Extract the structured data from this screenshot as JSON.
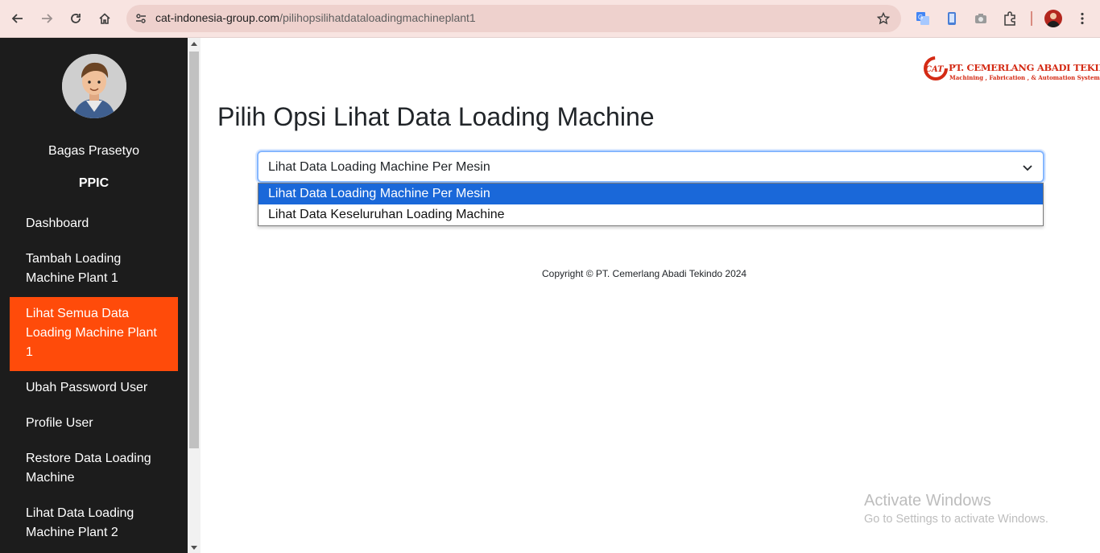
{
  "browser": {
    "url_domain": "cat-indonesia-group.com",
    "url_path": "/pilihopsilihatdataloadingmachineplant1"
  },
  "sidebar": {
    "user_name": "Bagas Prasetyo",
    "user_role": "PPIC",
    "items": [
      {
        "label": "Dashboard"
      },
      {
        "label": "Tambah Loading Machine Plant 1"
      },
      {
        "label": "Lihat Semua Data Loading Machine Plant 1"
      },
      {
        "label": "Ubah Password User"
      },
      {
        "label": "Profile User"
      },
      {
        "label": "Restore Data Loading Machine"
      },
      {
        "label": "Lihat Data Loading Machine Plant 2"
      }
    ],
    "active_color": "#ff4b0a"
  },
  "logo": {
    "mark": "CAT",
    "company": "PT. CEMERLANG ABADI TEKINDO",
    "tagline": "Machining , Fabrication , & Automation System"
  },
  "main": {
    "title": "Pilih Opsi Lihat Data Loading Machine",
    "select": {
      "selected": "Lihat Data Loading Machine Per Mesin",
      "options": [
        "Lihat Data Loading Machine Per Mesin",
        "Lihat Data Keseluruhan Loading Machine"
      ]
    },
    "copyright": "Copyright © PT. Cemerlang Abadi Tekindo 2024"
  },
  "watermark": {
    "line1": "Activate Windows",
    "line2": "Go to Settings to activate Windows."
  }
}
